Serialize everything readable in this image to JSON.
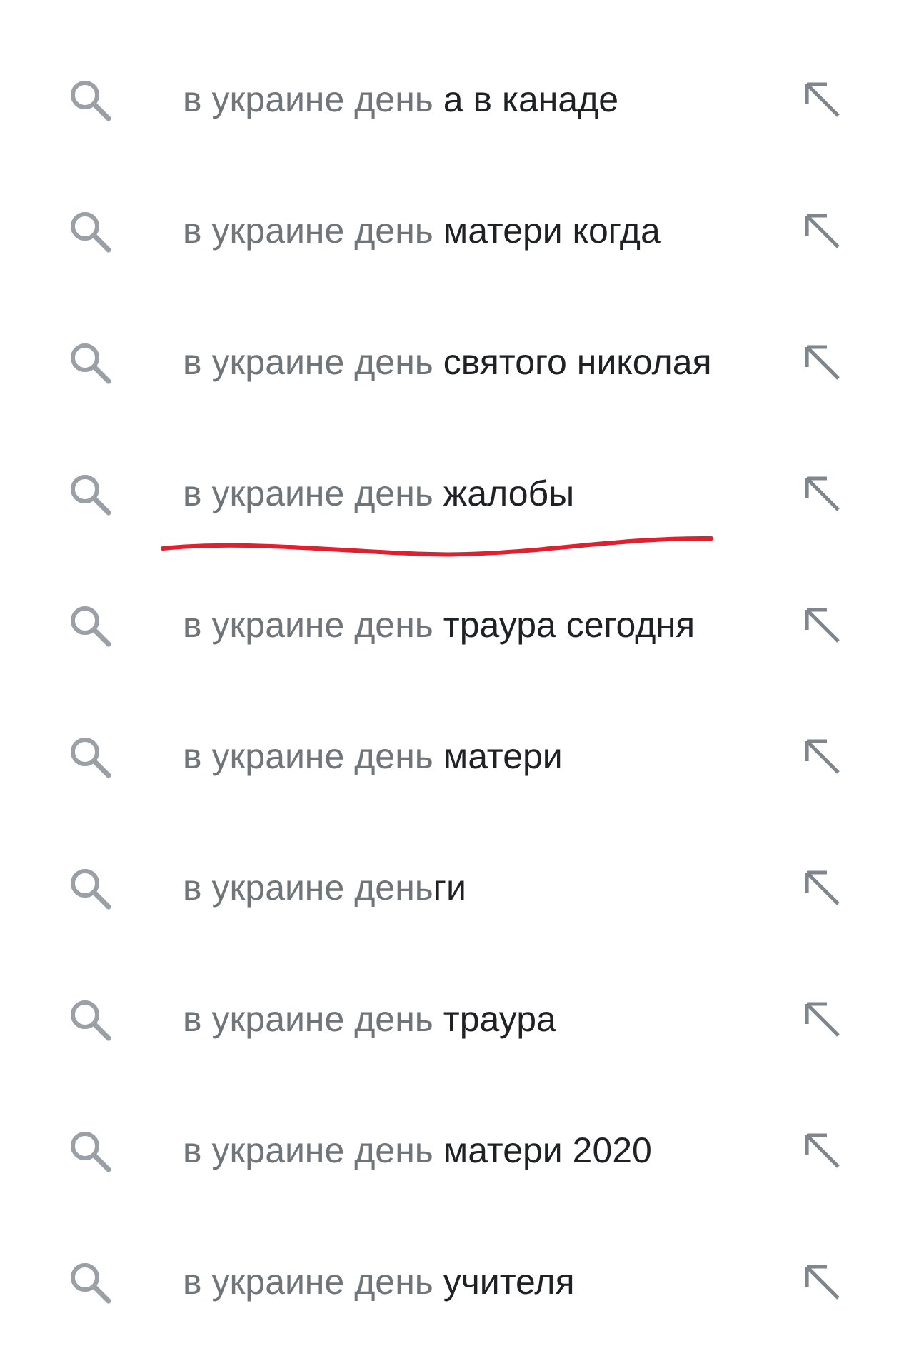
{
  "suggestions": [
    {
      "prefix": "в украине день ",
      "completion": "а в канаде",
      "underlined": false
    },
    {
      "prefix": "в украине день ",
      "completion": "матери когда",
      "underlined": false
    },
    {
      "prefix": "в украине день ",
      "completion": "святого николая",
      "underlined": false
    },
    {
      "prefix": "в украине день ",
      "completion": "жалобы",
      "underlined": true
    },
    {
      "prefix": "в украине день ",
      "completion": "траура сегодня",
      "underlined": false
    },
    {
      "prefix": "в украине день ",
      "completion": "матери",
      "underlined": false
    },
    {
      "prefix": "в украине день",
      "completion": "ги",
      "underlined": false
    },
    {
      "prefix": "в украине день ",
      "completion": "траура",
      "underlined": false
    },
    {
      "prefix": "в украине день ",
      "completion": "матери 2020",
      "underlined": false
    },
    {
      "prefix": "в украине день ",
      "completion": "учителя",
      "underlined": false
    }
  ]
}
